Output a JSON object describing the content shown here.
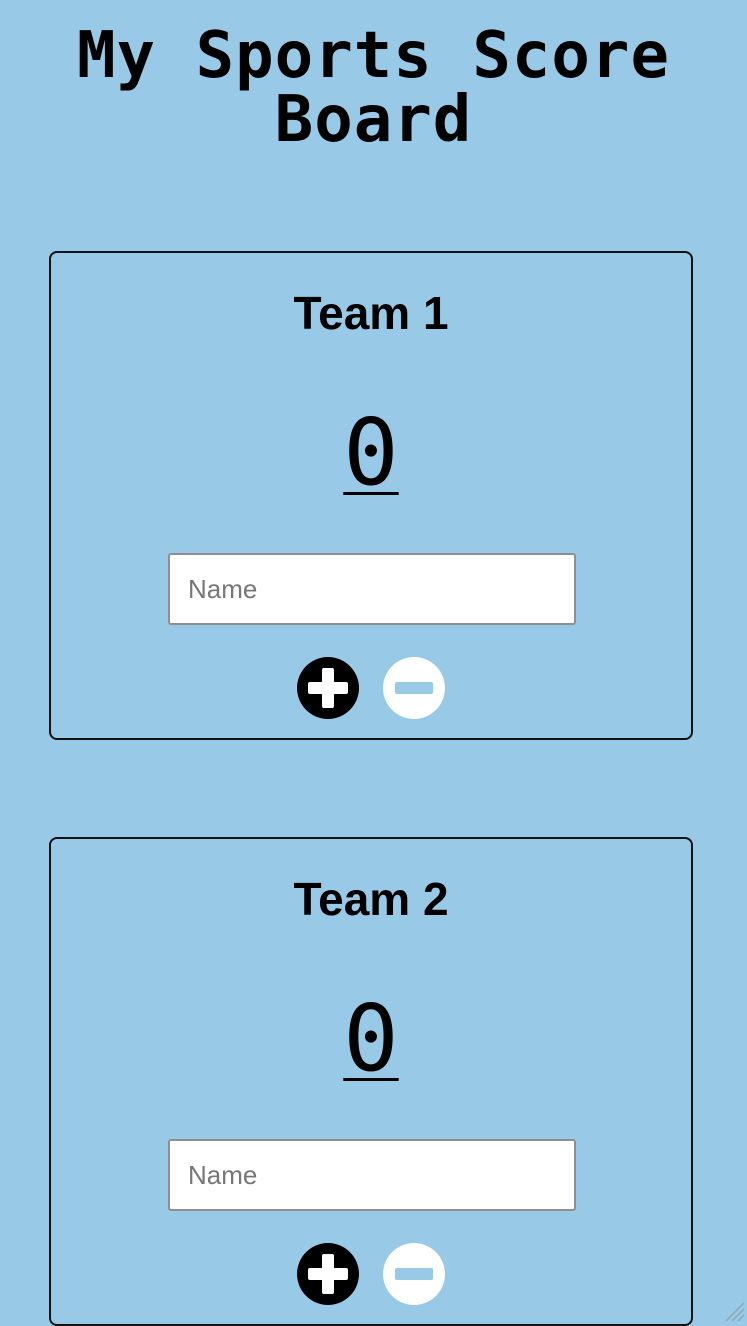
{
  "page": {
    "title": "My Sports Score Board"
  },
  "teams": [
    {
      "name": "Team 1",
      "score": "0",
      "name_placeholder": "Name"
    },
    {
      "name": "Team 2",
      "score": "0",
      "name_placeholder": "Name"
    }
  ],
  "icons": {
    "increment": "plus-circle-icon",
    "decrement": "minus-circle-icon"
  },
  "colors": {
    "background": "#98cae8",
    "plus_button": "#000000",
    "minus_button": "#ffffff",
    "minus_glyph": "#98cae8"
  }
}
